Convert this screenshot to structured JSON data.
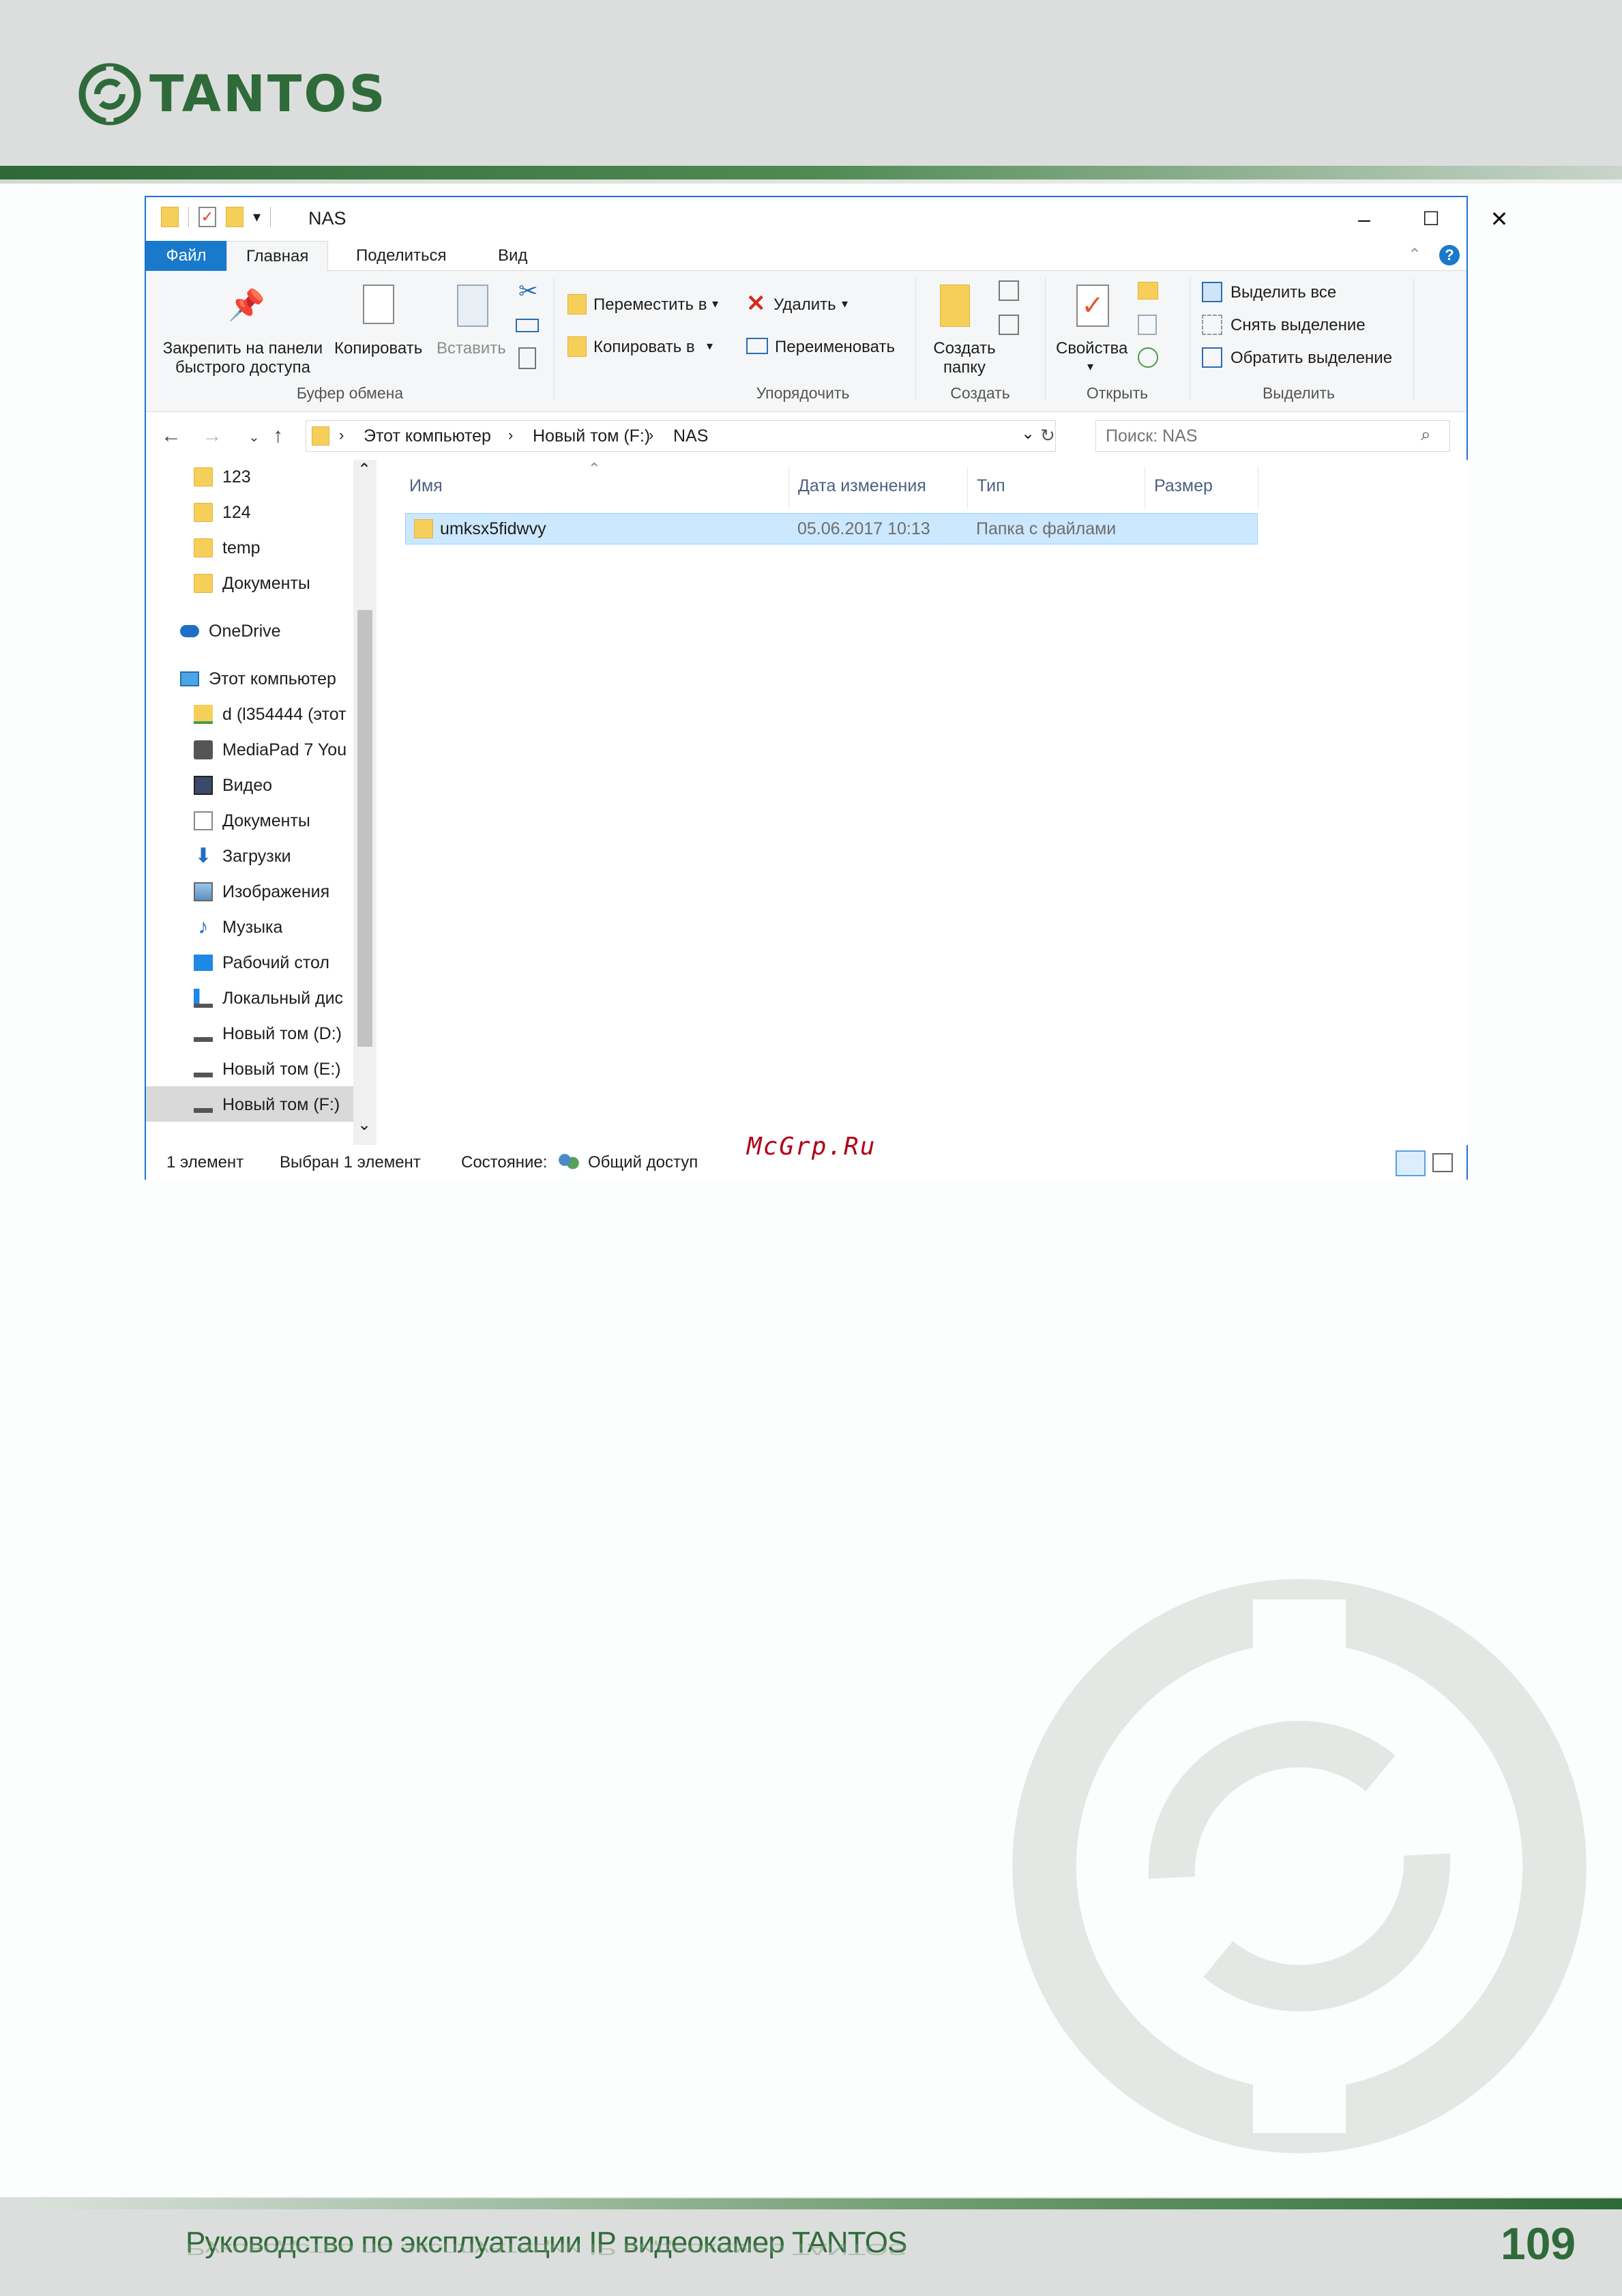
{
  "header": {
    "logo_text": "TANTOS"
  },
  "window": {
    "title": "NAS",
    "tabs": [
      "Файл",
      "Главная",
      "Поделиться",
      "Вид"
    ],
    "ribbon": {
      "pin_label_1": "Закрепить на панели",
      "pin_label_2": "быстрого доступа",
      "copy": "Копировать",
      "paste": "Вставить",
      "clipboard_group": "Буфер обмена",
      "move_to": "Переместить в",
      "copy_to": "Копировать в",
      "delete": "Удалить",
      "rename": "Переименовать",
      "organize_group": "Упорядочить",
      "new_folder_1": "Создать",
      "new_folder_2": "папку",
      "new_group": "Создать",
      "properties": "Свойства",
      "open_group": "Открыть",
      "select_all": "Выделить все",
      "select_none": "Снять выделение",
      "invert_selection": "Обратить выделение",
      "select_group": "Выделить"
    },
    "address": {
      "path": [
        "Этот компьютер",
        "Новый том (F:)",
        "NAS"
      ],
      "search_placeholder": "Поиск: NAS"
    },
    "nav": [
      {
        "label": "123",
        "icon": "folder-icon"
      },
      {
        "label": "124",
        "icon": "folder-icon"
      },
      {
        "label": "temp",
        "icon": "folder-icon"
      },
      {
        "label": "Документы",
        "icon": "folder-icon"
      },
      {
        "label": "OneDrive",
        "icon": "cloud-icon"
      },
      {
        "label": "Этот компьютер",
        "icon": "computer-icon"
      },
      {
        "label": "d (l354444 (этот",
        "icon": "network-drive-icon"
      },
      {
        "label": "MediaPad 7 You",
        "icon": "camera-icon"
      },
      {
        "label": "Видео",
        "icon": "video-icon"
      },
      {
        "label": "Документы",
        "icon": "documents-icon"
      },
      {
        "label": "Загрузки",
        "icon": "download-icon"
      },
      {
        "label": "Изображения",
        "icon": "pictures-icon"
      },
      {
        "label": "Музыка",
        "icon": "music-icon"
      },
      {
        "label": "Рабочий стол",
        "icon": "desktop-icon"
      },
      {
        "label": "Локальный дис",
        "icon": "local-disk-icon"
      },
      {
        "label": "Новый том (D:)",
        "icon": "drive-icon"
      },
      {
        "label": "Новый том (E:)",
        "icon": "drive-icon"
      },
      {
        "label": "Новый том (F:)",
        "icon": "drive-icon"
      }
    ],
    "columns": {
      "name": "Имя",
      "date": "Дата изменения",
      "type": "Тип",
      "size": "Размер"
    },
    "files": [
      {
        "name": "umksx5fidwvy",
        "date": "05.06.2017 10:13",
        "type": "Папка с файлами",
        "size": ""
      }
    ],
    "status": {
      "count": "1 элемент",
      "selected": "Выбран 1 элемент",
      "state_label": "Состояние:",
      "state_value": "Общий доступ"
    }
  },
  "watermark_text": "McGrp.Ru",
  "footer": {
    "title": "Руководство по эксплуатации IP видеокамер TANTOS",
    "page_number": "109"
  },
  "colors": {
    "brand_green": "#2f6b3a",
    "accent_blue": "#1979ca",
    "selection": "#cce8ff"
  }
}
